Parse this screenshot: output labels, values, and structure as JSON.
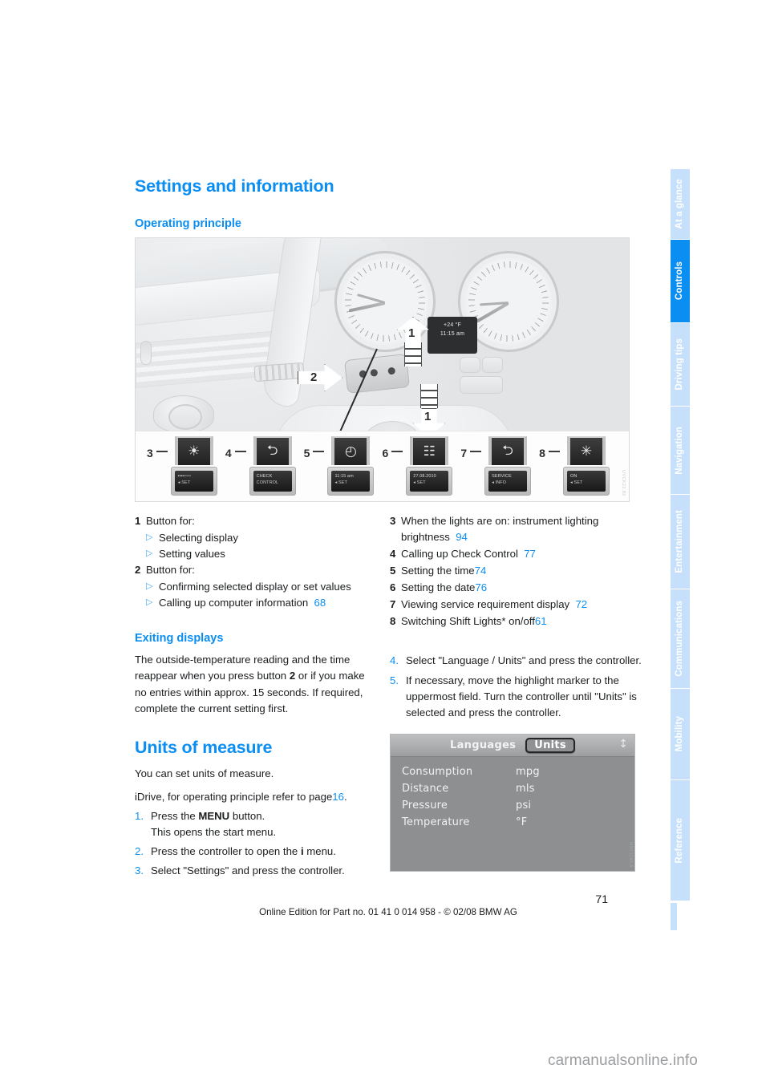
{
  "document": {
    "title": "Settings and information",
    "section_heading": "Operating principle"
  },
  "sidebar": {
    "tabs": [
      {
        "label": "At a glance",
        "active": false
      },
      {
        "label": "Controls",
        "active": true
      },
      {
        "label": "Driving tips",
        "active": false
      },
      {
        "label": "Navigation",
        "active": false
      },
      {
        "label": "Entertainment",
        "active": false
      },
      {
        "label": "Communications",
        "active": false
      },
      {
        "label": "Mobility",
        "active": false
      },
      {
        "label": "Reference",
        "active": false
      }
    ]
  },
  "figure": {
    "cluster_display": {
      "temp": "+24 °F",
      "time": "11:15 am"
    },
    "callouts": [
      {
        "num": "1",
        "direction": "up"
      },
      {
        "num": "2",
        "direction": "right"
      },
      {
        "num": "1",
        "direction": "down"
      }
    ],
    "icon_items": [
      {
        "num": "3",
        "icon": "brightness-icon",
        "glyph": "☀",
        "screen_line1": "▪▪▪▪▫▫▫▫",
        "screen_line2": "◂ SET"
      },
      {
        "num": "4",
        "icon": "car-icon",
        "glyph": "⮌",
        "screen_line1": "CHECK",
        "screen_line2": "CONTROL"
      },
      {
        "num": "5",
        "icon": "clock-icon",
        "glyph": "◴",
        "screen_line1": "11:15 am",
        "screen_line2": "◂ SET"
      },
      {
        "num": "6",
        "icon": "date-icon",
        "glyph": "☷",
        "screen_line1": "27.08.2010",
        "screen_line2": "◂ SET"
      },
      {
        "num": "7",
        "icon": "service-car-icon",
        "glyph": "⮌",
        "screen_line1": "SERVICE",
        "screen_line2": "◂ INFO"
      },
      {
        "num": "8",
        "icon": "shift-light-icon",
        "glyph": "✳",
        "screen_line1": "ON",
        "screen_line2": "◂ SET"
      }
    ],
    "watermark": "UVCK22.82"
  },
  "legend": {
    "left": [
      {
        "num": "1",
        "text": "Button for:",
        "subs": [
          {
            "text": "Selecting display",
            "page": ""
          },
          {
            "text": "Setting values",
            "page": ""
          }
        ]
      },
      {
        "num": "2",
        "text": "Button for:",
        "subs": [
          {
            "text": "Confirming selected display or set values",
            "page": ""
          },
          {
            "text": "Calling up computer information",
            "page": "68"
          }
        ]
      }
    ],
    "right": [
      {
        "num": "3",
        "text": "When the lights are on: instrument lighting brightness",
        "page": "94"
      },
      {
        "num": "4",
        "text": "Calling up Check Control",
        "page": "77"
      },
      {
        "num": "5",
        "text": "Setting the time",
        "page": "74"
      },
      {
        "num": "6",
        "text": "Setting the date",
        "page": "76"
      },
      {
        "num": "7",
        "text": "Viewing service requirement display",
        "page": "72"
      },
      {
        "num": "8",
        "text": "Switching Shift Lights* on/off",
        "page": "61"
      }
    ]
  },
  "exiting_displays": {
    "heading": "Exiting displays",
    "body_part1": "The outside-temperature reading and the time reappear when you press button ",
    "body_bold": "2",
    "body_part2": " or if you make no entries within approx. 15 seconds. If required, complete the current setting first."
  },
  "units_of_measure": {
    "heading": "Units of measure",
    "intro": "You can set units of measure.",
    "idrive_note_part1": "iDrive, for operating principle refer to page",
    "idrive_note_page": "16",
    "steps": [
      {
        "num": "1.",
        "part1": "Press the ",
        "bold": "MENU",
        "part2": " button.",
        "extra": "This opens the start menu."
      },
      {
        "num": "2.",
        "part1": "Press the controller to open the ",
        "bold": "i",
        "part2": " menu.",
        "extra": ""
      },
      {
        "num": "3.",
        "part1": "Select \"Settings\" and press the controller.",
        "bold": "",
        "part2": "",
        "extra": ""
      },
      {
        "num": "4.",
        "part1": "Select \"Language / Units\" and press the controller.",
        "bold": "",
        "part2": "",
        "extra": ""
      },
      {
        "num": "5.",
        "part1": "If necessary, move the highlight marker to the uppermost field. Turn the controller until \"Units\" is selected and press the controller.",
        "bold": "",
        "part2": "",
        "extra": ""
      }
    ]
  },
  "idrive_screen": {
    "tab_inactive": "Languages",
    "tab_active": "Units",
    "rows": [
      {
        "label": "Consumption",
        "value": "mpg"
      },
      {
        "label": "Distance",
        "value": "mls"
      },
      {
        "label": "Pressure",
        "value": "psi"
      },
      {
        "label": "Temperature",
        "value": "°F"
      }
    ],
    "watermark": "MN5324A.A"
  },
  "footer": {
    "page_number": "71",
    "edition": "Online Edition for Part no. 01 41 0 014 958 - © 02/08 BMW AG"
  },
  "site_watermark": "carmanualsonline.info",
  "colors": {
    "accent_blue": "#0b8ef2",
    "tab_light_blue": "#c6e0fb",
    "bullet_blue": "#4aa9f5",
    "text_black": "#1a1c1e"
  }
}
